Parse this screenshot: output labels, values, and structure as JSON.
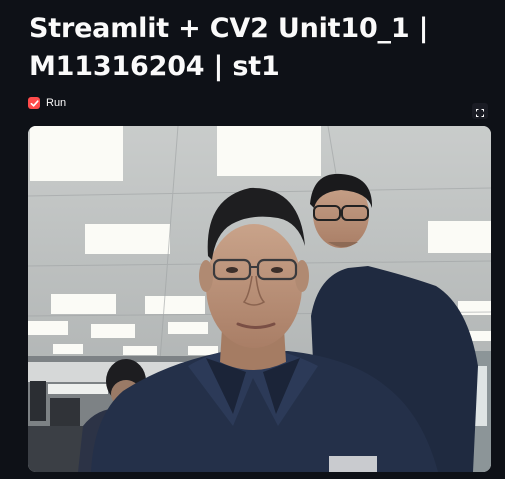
{
  "page": {
    "title": "Streamlit + CV2 Unit10_1 | M11316204 | st1"
  },
  "controls": {
    "run_checkbox": {
      "label": "Run",
      "checked": true
    },
    "fullscreen_icon": "fullscreen-icon"
  },
  "colors": {
    "background": "#0e1117",
    "accent": "#ff4b4b",
    "text": "#fafafa"
  }
}
